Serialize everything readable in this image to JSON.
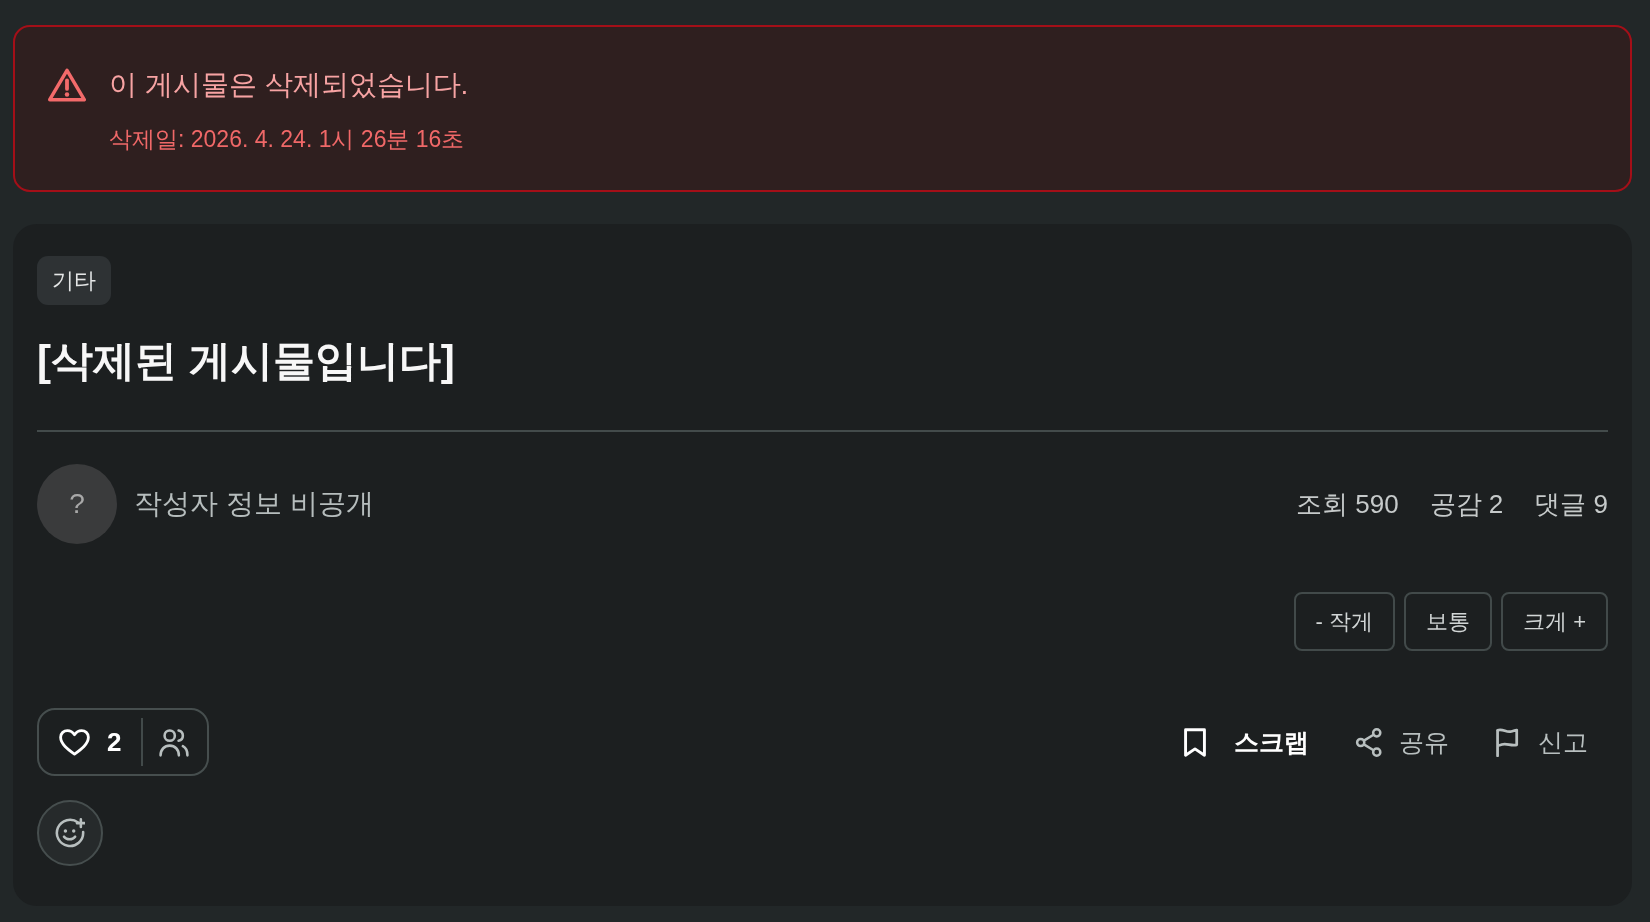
{
  "notice": {
    "title": "이 게시물은 삭제되었습니다.",
    "deleted_at": "삭제일: 2026. 4. 24. 1시 26분 16초"
  },
  "post": {
    "category": "기타",
    "title": "[삭제된 게시물입니다]",
    "author": {
      "avatar": "?",
      "name": "작성자 정보 비공개"
    },
    "stats": [
      "조회 590",
      "공감 2",
      "댓글 9"
    ],
    "font_sizes": [
      "- 작게",
      "보통",
      "크게 +"
    ],
    "like_count": "2",
    "actions": [
      {
        "kind": "bookmark",
        "label": "스크랩",
        "highlighted": true
      },
      {
        "kind": "share",
        "label": "공유",
        "highlighted": false
      },
      {
        "kind": "flag",
        "label": "신고",
        "highlighted": false
      }
    ]
  }
}
